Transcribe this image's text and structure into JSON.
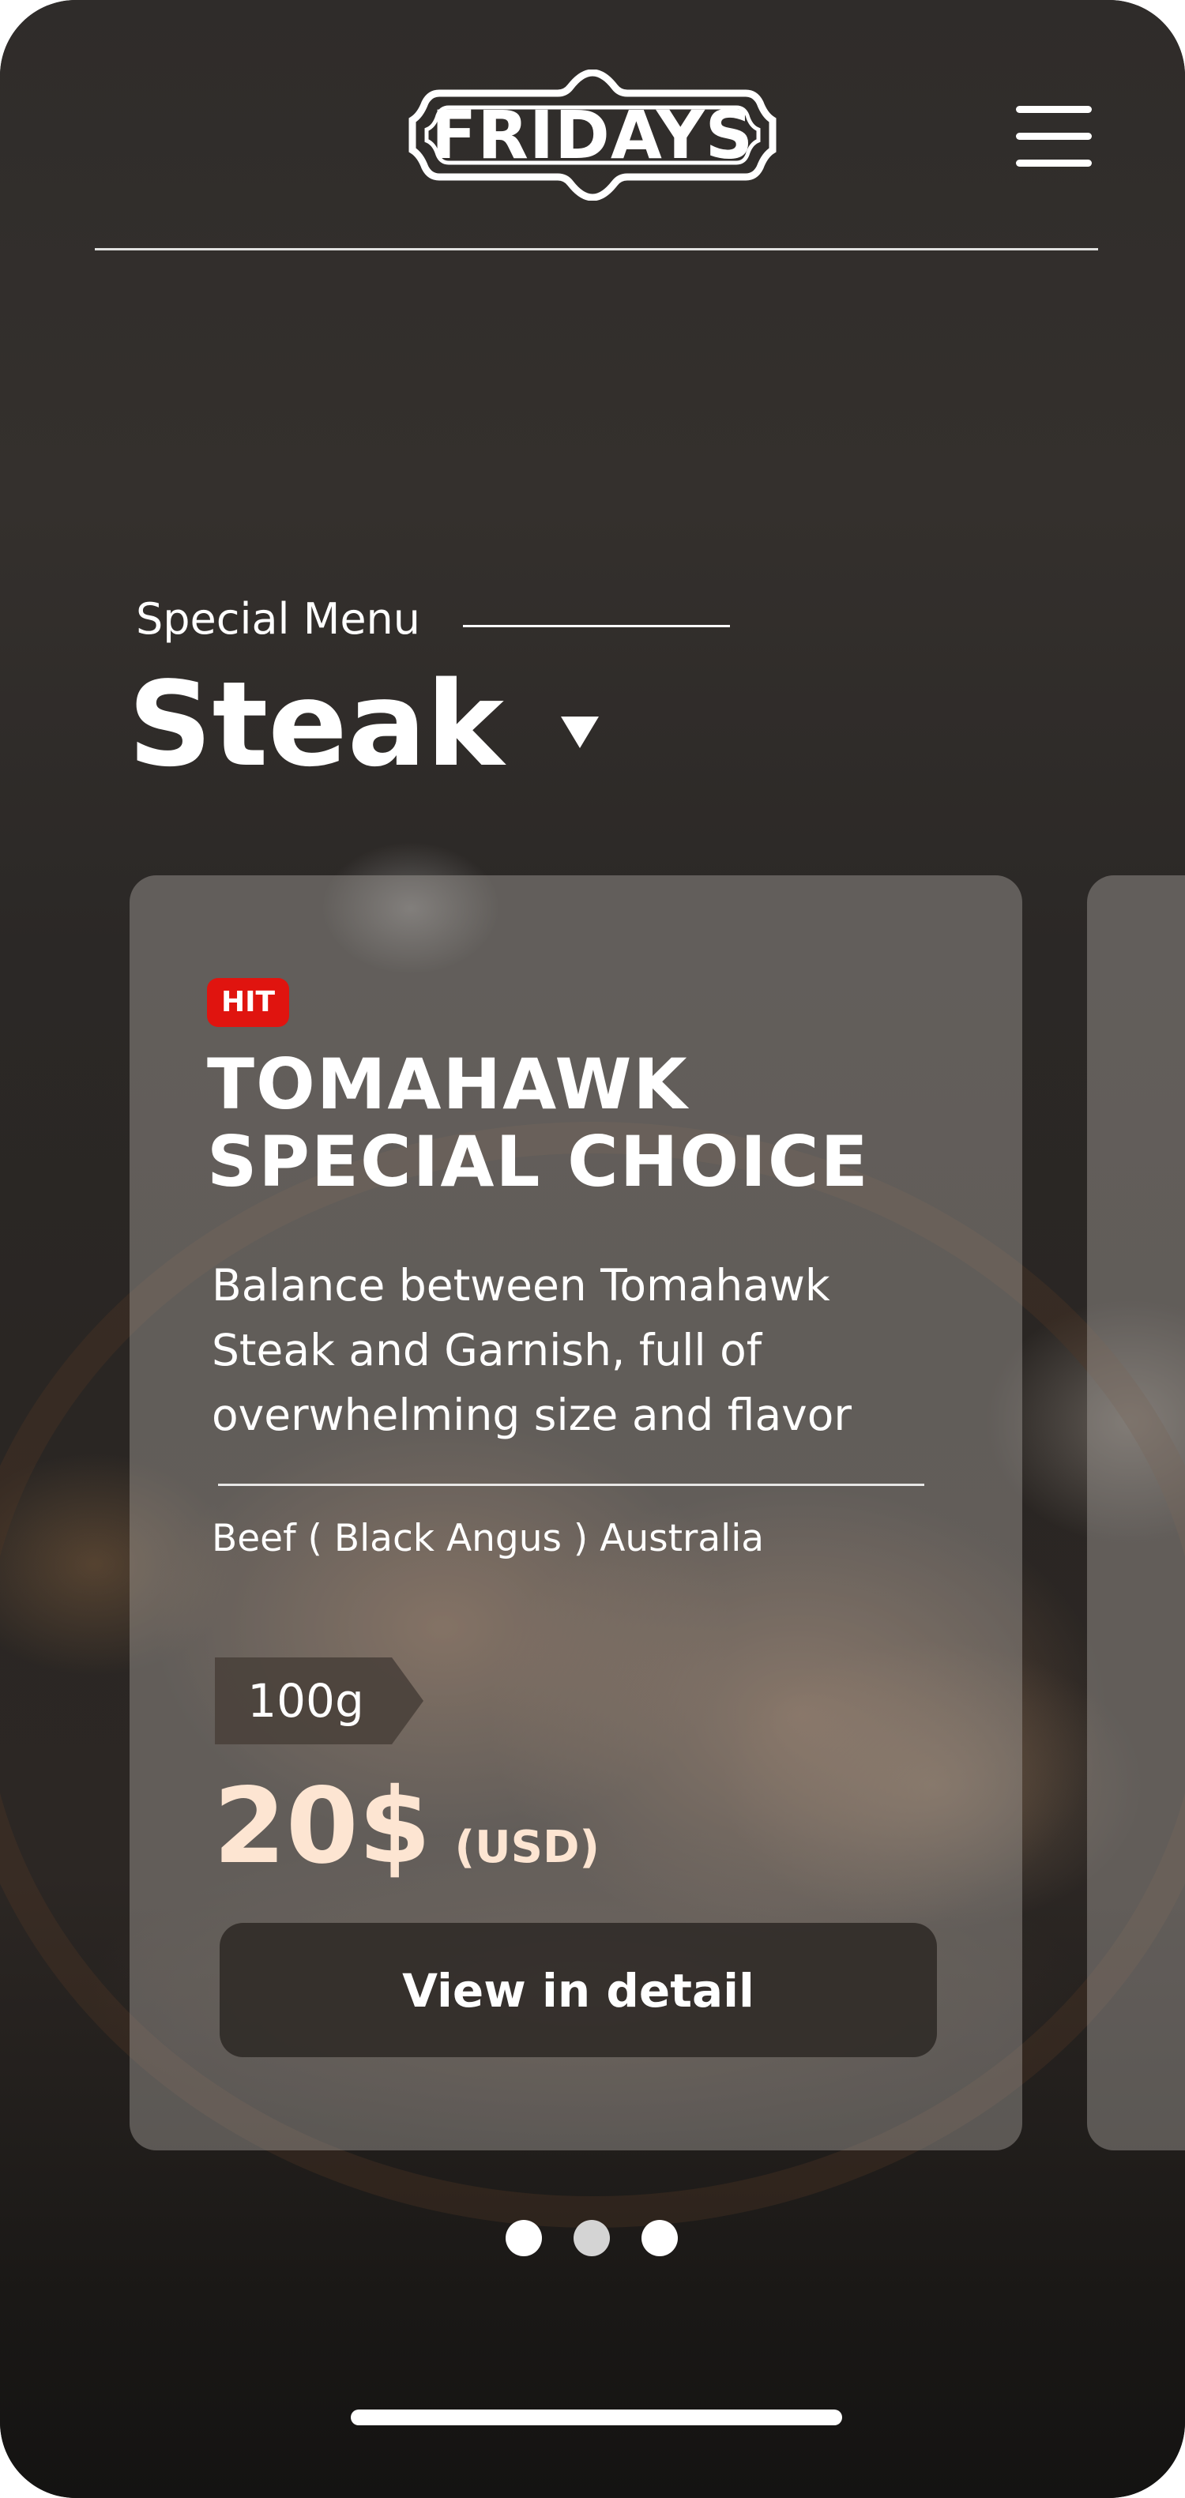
{
  "header": {
    "logo_text": "FRIDAYS",
    "menu_icon": "hamburger-menu-icon"
  },
  "section": {
    "eyebrow": "Special Menu",
    "category": "Steak",
    "category_icon": "caret-down-icon"
  },
  "card": {
    "badge": "HIT",
    "title_line1": "TOMAHAWK",
    "title_line2": "SPECIAL CHOICE",
    "description": "Balance between Tomahawk Steak and Garnish, full of overwhelming size and flavor",
    "origin": "Beef ( Black Angus ) Australia",
    "weight": "100g",
    "price": "20$",
    "currency": "(USD)",
    "button_label": "View in detail"
  },
  "pagination": {
    "count": 3
  },
  "colors": {
    "badge": "#e0140f",
    "price": "#fde5d2",
    "button": "#2d2825"
  }
}
